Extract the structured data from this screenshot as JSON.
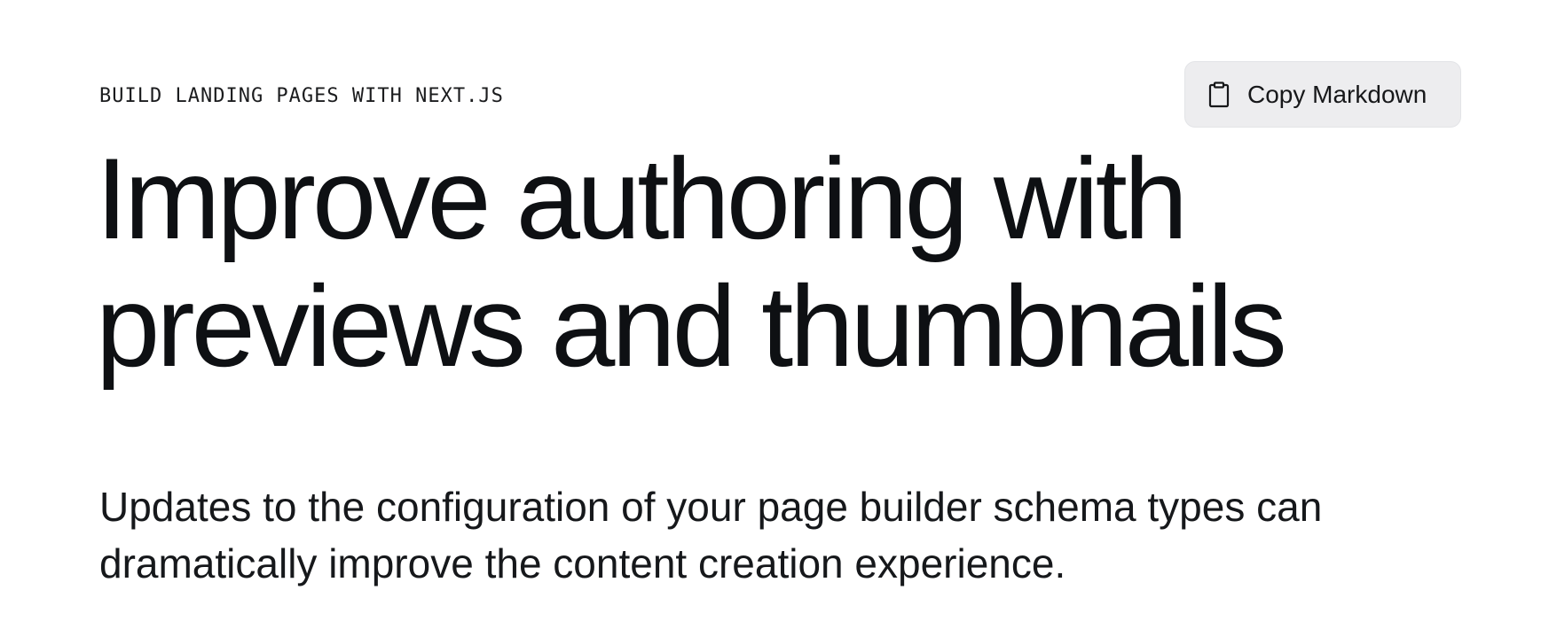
{
  "page": {
    "eyebrow": "BUILD LANDING PAGES WITH NEXT.JS",
    "copy_button": {
      "label": "Copy Markdown",
      "icon": "clipboard-icon"
    },
    "headline": {
      "line1": "Improve authoring with",
      "line2": "previews and thumbnails"
    },
    "lede": {
      "line1": "Updates to the configuration of your page builder schema types can",
      "line2": "dramatically improve the content creation experience."
    }
  },
  "colors": {
    "background": "#ffffff",
    "text": "#101112",
    "button_bg": "#ededef"
  }
}
